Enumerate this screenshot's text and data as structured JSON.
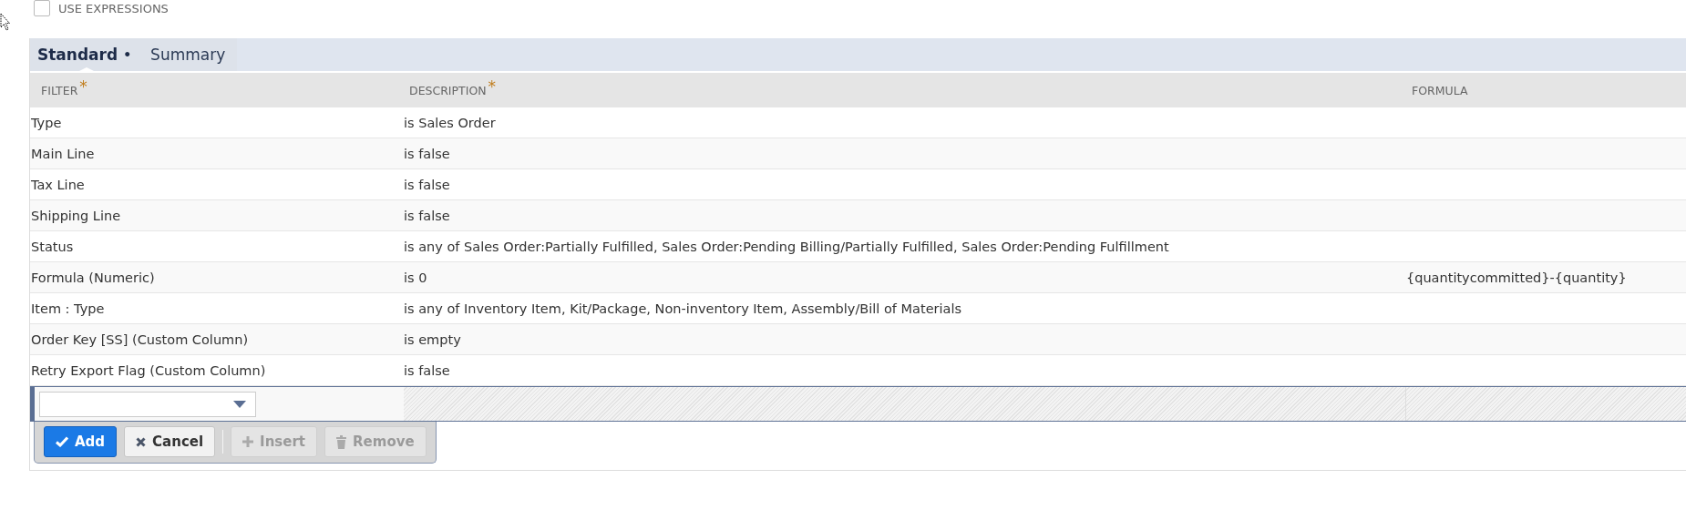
{
  "use_expressions": {
    "label": "USE EXPRESSIONS",
    "checked": false
  },
  "tabs": [
    {
      "label": "Standard",
      "indicator": "•",
      "selected": true
    },
    {
      "label": "Summary",
      "selected": false
    }
  ],
  "table": {
    "columns": [
      {
        "label": "FILTER",
        "required_mark": "*"
      },
      {
        "label": "DESCRIPTION",
        "required_mark": "*"
      },
      {
        "label": "FORMULA"
      }
    ],
    "rows": [
      [
        "Type",
        "is Sales Order",
        ""
      ],
      [
        "Main Line",
        "is false",
        ""
      ],
      [
        "Tax Line",
        "is false",
        ""
      ],
      [
        "Shipping Line",
        "is false",
        ""
      ],
      [
        "Status",
        "is any of Sales Order:Partially Fulfilled, Sales Order:Pending Billing/Partially Fulfilled, Sales Order:Pending Fulfillment",
        ""
      ],
      [
        "Formula (Numeric)",
        "is 0",
        "{quantitycommitted}-{quantity}"
      ],
      [
        "Item : Type",
        "is any of Inventory Item, Kit/Package, Non-inventory Item, Assembly/Bill of Materials",
        ""
      ],
      [
        "Order Key [SS] (Custom Column)",
        "is empty",
        ""
      ],
      [
        "Retry Export Flag (Custom Column)",
        "is false",
        ""
      ]
    ]
  },
  "buttons": [
    {
      "label": "Add",
      "kind": "add",
      "disabled": false
    },
    {
      "label": "Cancel",
      "kind": "cancel",
      "disabled": false
    },
    {
      "kind": "separator"
    },
    {
      "label": "Insert",
      "kind": "insert",
      "disabled": true
    },
    {
      "label": "Remove",
      "kind": "remove",
      "disabled": true
    }
  ]
}
